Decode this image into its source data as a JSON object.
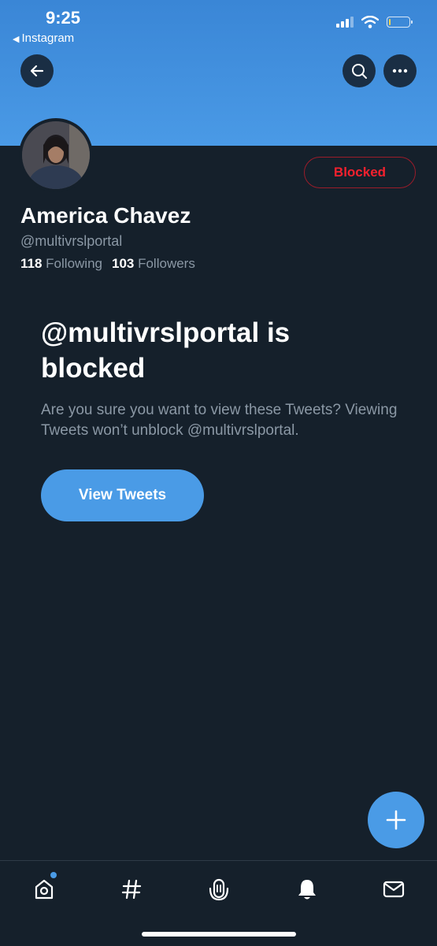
{
  "status": {
    "time": "9:25",
    "back_app": "Instagram",
    "battery_level": 0.1
  },
  "profile": {
    "display_name": "America Chavez",
    "handle": "@multivrslportal",
    "following_count": "118",
    "following_label": "Following",
    "followers_count": "103",
    "followers_label": "Followers",
    "blocked_label": "Blocked"
  },
  "block_notice": {
    "title": "@multivrslportal is blocked",
    "description": "Are you sure you want to view these Tweets? Viewing Tweets won’t unblock @multivrslportal.",
    "view_button": "View Tweets"
  },
  "icons": {
    "back": "arrow-left-icon",
    "search": "search-icon",
    "more": "more-icon",
    "compose": "plus-icon",
    "tabs": [
      "home-icon",
      "hashtag-icon",
      "spaces-icon",
      "bell-icon",
      "mail-icon"
    ]
  },
  "colors": {
    "background": "#15202b",
    "accent": "#4a9be6",
    "blocked": "#f4212e",
    "secondary_text": "#8b98a5"
  }
}
